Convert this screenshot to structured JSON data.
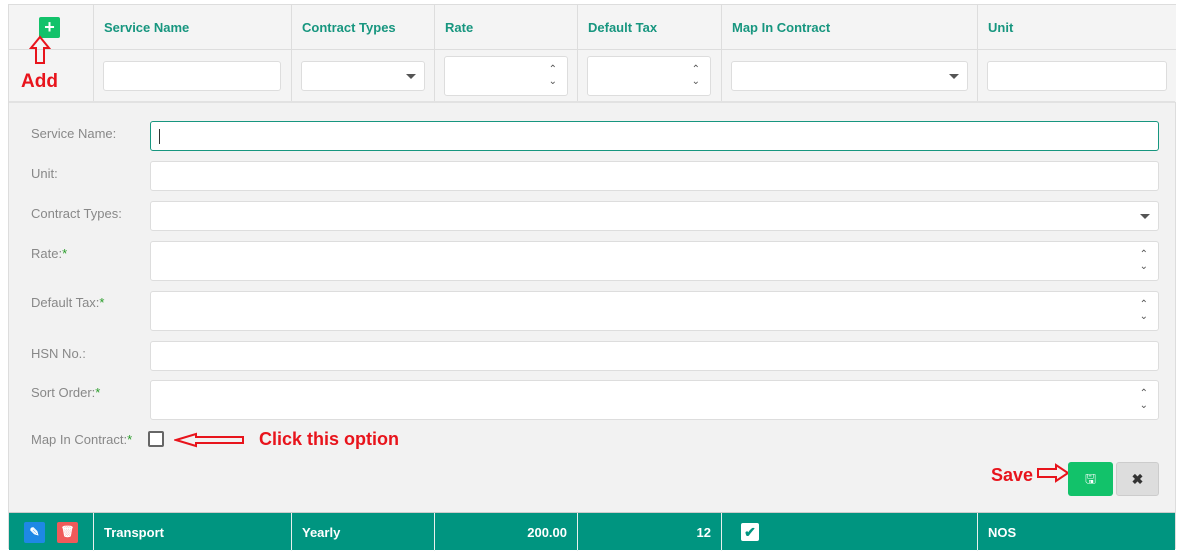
{
  "columns": [
    "Service Name",
    "Contract Types",
    "Rate",
    "Default Tax",
    "Map In Contract",
    "Unit"
  ],
  "annotations": {
    "add": "Add",
    "click": "Click this option",
    "save": "Save"
  },
  "form": {
    "service_name": "Service Name:",
    "unit": "Unit:",
    "contract_types": "Contract Types:",
    "rate": "Rate:",
    "default_tax": "Default Tax:",
    "hsn": "HSN No.:",
    "sort_order": "Sort Order:",
    "map_in_contract": "Map In Contract:",
    "required": "*"
  },
  "row": {
    "service_name": "Transport",
    "contract_type": "Yearly",
    "rate": "200.00",
    "default_tax": "12",
    "map_in_contract": true,
    "unit": "NOS"
  },
  "colors": {
    "accent": "#009580",
    "save": "#12c26a",
    "delete": "#f05a5a",
    "edit": "#1e88e5"
  }
}
